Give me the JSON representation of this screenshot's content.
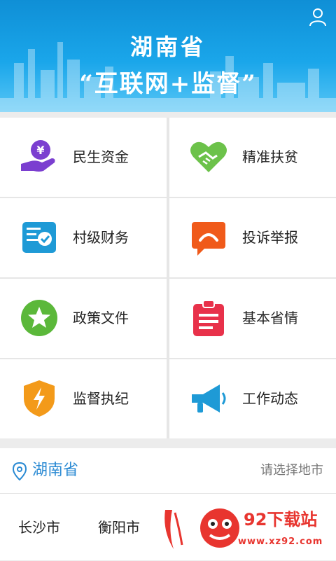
{
  "banner": {
    "title_line1": "湖南省",
    "title_line2": "“互联网+监督”"
  },
  "modules": [
    {
      "label": "民生资金",
      "icon": "money-hand-icon",
      "color": "#7b3fd0"
    },
    {
      "label": "精准扶贫",
      "icon": "heart-handshake-icon",
      "color": "#6cc24a"
    },
    {
      "label": "村级财务",
      "icon": "finance-document-icon",
      "color": "#1e9ad6"
    },
    {
      "label": "投诉举报",
      "icon": "complaint-bubble-icon",
      "color": "#f05a1a"
    },
    {
      "label": "政策文件",
      "icon": "star-circle-icon",
      "color": "#5bb83a"
    },
    {
      "label": "基本省情",
      "icon": "clipboard-icon",
      "color": "#e8314a"
    },
    {
      "label": "监督执纪",
      "icon": "lightning-shield-icon",
      "color": "#f39a1a"
    },
    {
      "label": "工作动态",
      "icon": "megaphone-icon",
      "color": "#1e9ad6"
    }
  ],
  "region": {
    "province": "湖南省",
    "select_label": "请选择地市"
  },
  "cities": [
    "长沙市",
    "衡阳市"
  ],
  "watermark": {
    "brand": "92下载站",
    "url": "www.xz92.com"
  },
  "colors": {
    "banner_blue": "#1aa6ea",
    "region_blue": "#2a8ad3",
    "watermark_red": "#e8352f"
  }
}
